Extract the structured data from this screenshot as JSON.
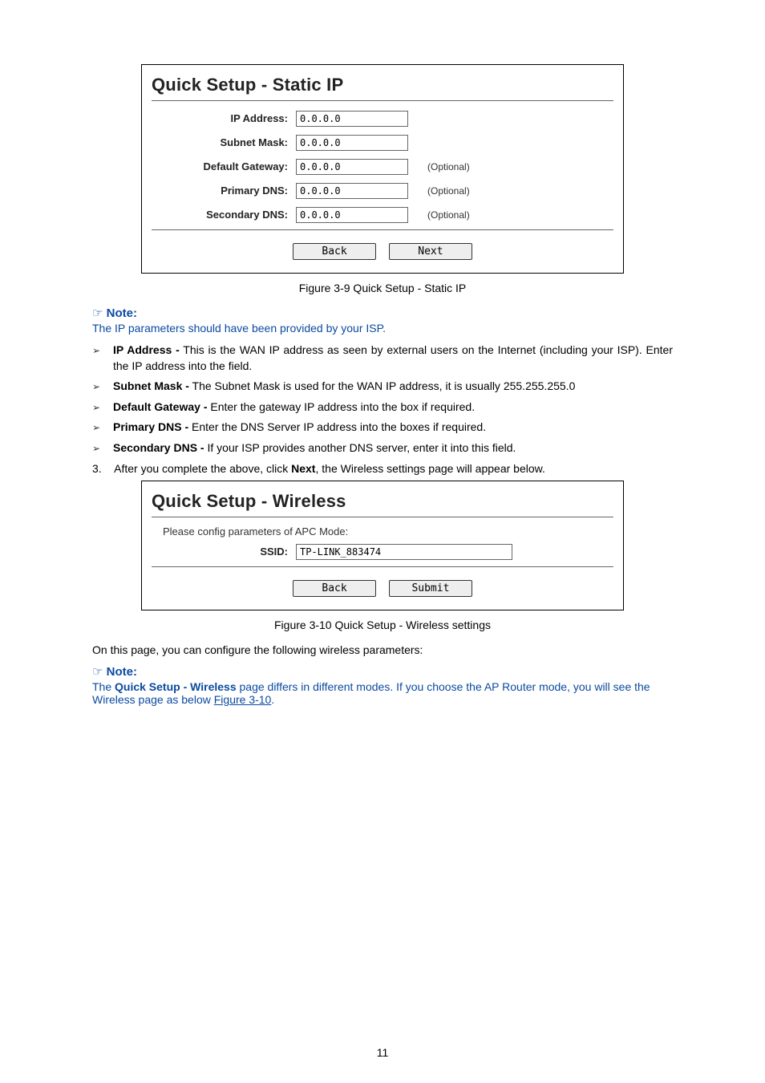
{
  "figure1": {
    "title": "Quick Setup - Static IP",
    "rows": [
      {
        "label": "IP Address:",
        "value": "0.0.0.0",
        "hint": ""
      },
      {
        "label": "Subnet Mask:",
        "value": "0.0.0.0",
        "hint": ""
      },
      {
        "label": "Default Gateway:",
        "value": "0.0.0.0",
        "hint": "(Optional)"
      },
      {
        "label": "Primary DNS:",
        "value": "0.0.0.0",
        "hint": "(Optional)"
      },
      {
        "label": "Secondary DNS:",
        "value": "0.0.0.0",
        "hint": "(Optional)"
      }
    ],
    "buttons": {
      "back": "Back",
      "next": "Next"
    },
    "caption": "Figure 3-9 Quick Setup - Static IP"
  },
  "note1": {
    "head": "Note:",
    "text": "The IP parameters should have been provided by your ISP."
  },
  "bullets": [
    {
      "key": "IP Address -",
      "text": " This is the WAN IP address as seen by external users on the Internet (including your ISP). Enter the IP address into the field."
    },
    {
      "key": "Subnet Mask -",
      "text": " The Subnet Mask is used for the WAN IP address, it is usually 255.255.255.0"
    },
    {
      "key": "Default Gateway -",
      "text": " Enter the gateway IP address into the box if required."
    },
    {
      "key": "Primary DNS -",
      "text": " Enter the DNS Server IP address into the boxes if required."
    },
    {
      "key": "Secondary DNS -",
      "text": " If your ISP provides another DNS server, enter it into this field."
    }
  ],
  "step3": {
    "num": "3.",
    "pre": "After you complete the above, click ",
    "click": "Next",
    "post": ", the Wireless settings page will appear below."
  },
  "figure2": {
    "title": "Quick Setup - Wireless",
    "prompt": "Please config parameters of APC Mode:",
    "ssid_label": "SSID:",
    "ssid_value": "TP-LINK_883474",
    "buttons": {
      "back": "Back",
      "submit": "Submit"
    },
    "caption": "Figure 3-10 Quick Setup - Wireless settings"
  },
  "configline": "On this page, you can configure the following wireless parameters:",
  "note2": {
    "head": "Note:",
    "pre": "The ",
    "key": "Quick Setup - Wireless",
    "mid": " page differs in different modes. If you choose the AP Router mode, you will see the Wireless page as below ",
    "link": "Figure 3-10",
    "post": "."
  },
  "pagenum": "11"
}
